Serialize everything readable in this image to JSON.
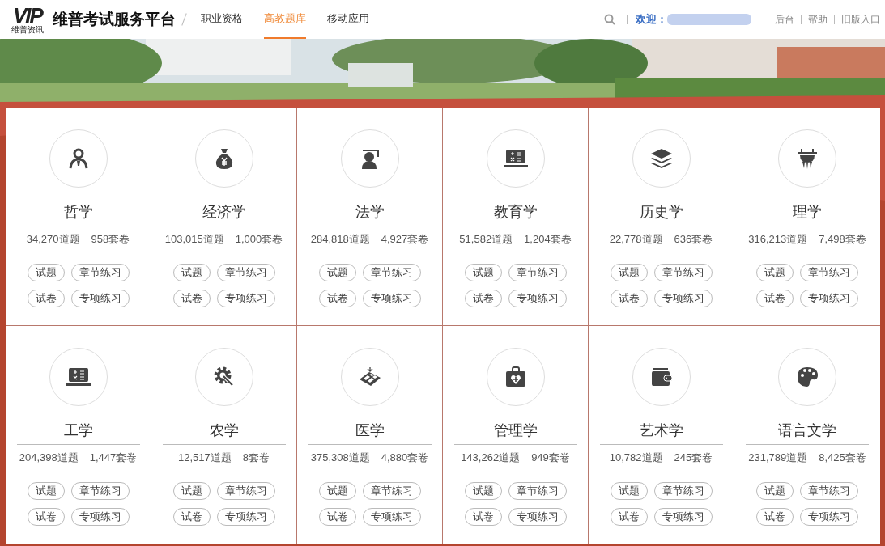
{
  "header": {
    "logo": {
      "mark": "VIP",
      "caption": "维普资讯"
    },
    "title": "维普考试服务平台",
    "nav": [
      {
        "label": "职业资格",
        "selected": false
      },
      {
        "label": "高教题库",
        "selected": true
      },
      {
        "label": "移动应用",
        "selected": false
      }
    ],
    "welcome": "欢迎：",
    "links": [
      "后台",
      "帮助",
      "旧版入口"
    ]
  },
  "subjects": [
    {
      "name": "哲学",
      "questions": "34,270道题",
      "papers": "958套卷",
      "buttons": [
        "试题",
        "章节练习",
        "试卷",
        "专项练习"
      ]
    },
    {
      "name": "经济学",
      "questions": "103,015道题",
      "papers": "1,000套卷",
      "buttons": [
        "试题",
        "章节练习",
        "试卷",
        "专项练习"
      ]
    },
    {
      "name": "法学",
      "questions": "284,818道题",
      "papers": "4,927套卷",
      "buttons": [
        "试题",
        "章节练习",
        "试卷",
        "专项练习"
      ]
    },
    {
      "name": "教育学",
      "questions": "51,582道题",
      "papers": "1,204套卷",
      "buttons": [
        "试题",
        "章节练习",
        "试卷",
        "专项练习"
      ]
    },
    {
      "name": "历史学",
      "questions": "22,778道题",
      "papers": "636套卷",
      "buttons": [
        "试题",
        "章节练习",
        "试卷",
        "专项练习"
      ]
    },
    {
      "name": "理学",
      "questions": "316,213道题",
      "papers": "7,498套卷",
      "buttons": [
        "试题",
        "章节练习",
        "试卷",
        "专项练习"
      ]
    },
    {
      "name": "工学",
      "questions": "204,398道题",
      "papers": "1,447套卷",
      "buttons": [
        "试题",
        "章节练习",
        "试卷",
        "专项练习"
      ]
    },
    {
      "name": "农学",
      "questions": "12,517道题",
      "papers": "8套卷",
      "buttons": [
        "试题",
        "章节练习",
        "试卷",
        "专项练习"
      ]
    },
    {
      "name": "医学",
      "questions": "375,308道题",
      "papers": "4,880套卷",
      "buttons": [
        "试题",
        "章节练习",
        "试卷",
        "专项练习"
      ]
    },
    {
      "name": "管理学",
      "questions": "143,262道题",
      "papers": "949套卷",
      "buttons": [
        "试题",
        "章节练习",
        "试卷",
        "专项练习"
      ]
    },
    {
      "name": "艺术学",
      "questions": "10,782道题",
      "papers": "245套卷",
      "buttons": [
        "试题",
        "章节练习",
        "试卷",
        "专项练习"
      ]
    },
    {
      "name": "语言文学",
      "questions": "231,789道题",
      "papers": "8,425套卷",
      "buttons": [
        "试题",
        "章节练习",
        "试卷",
        "专项练习"
      ]
    }
  ]
}
